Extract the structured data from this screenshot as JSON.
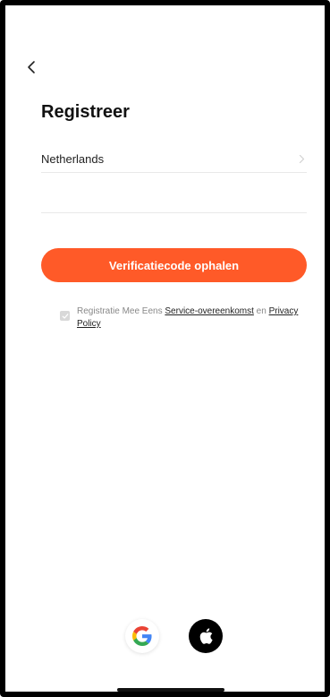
{
  "header": {
    "back_icon": "chevron-left-icon",
    "title": "Registreer"
  },
  "form": {
    "country": {
      "label": "Netherlands",
      "icon": "chevron-right-icon"
    },
    "account_field": {
      "value": "",
      "placeholder": ""
    },
    "primary_button_label": "Verificatiecode ophalen"
  },
  "agreement": {
    "checked": true,
    "prefix": "Registratie Mee Eens",
    "service_link": "Service-overeenkomst",
    "connector": "en",
    "privacy_link": "Privacy Policy"
  },
  "social_login": {
    "google_icon": "google-icon",
    "apple_icon": "apple-icon"
  },
  "colors": {
    "accent": "#ff5a28",
    "text": "#111111",
    "muted": "#888888",
    "divider": "#e9e9e9"
  }
}
